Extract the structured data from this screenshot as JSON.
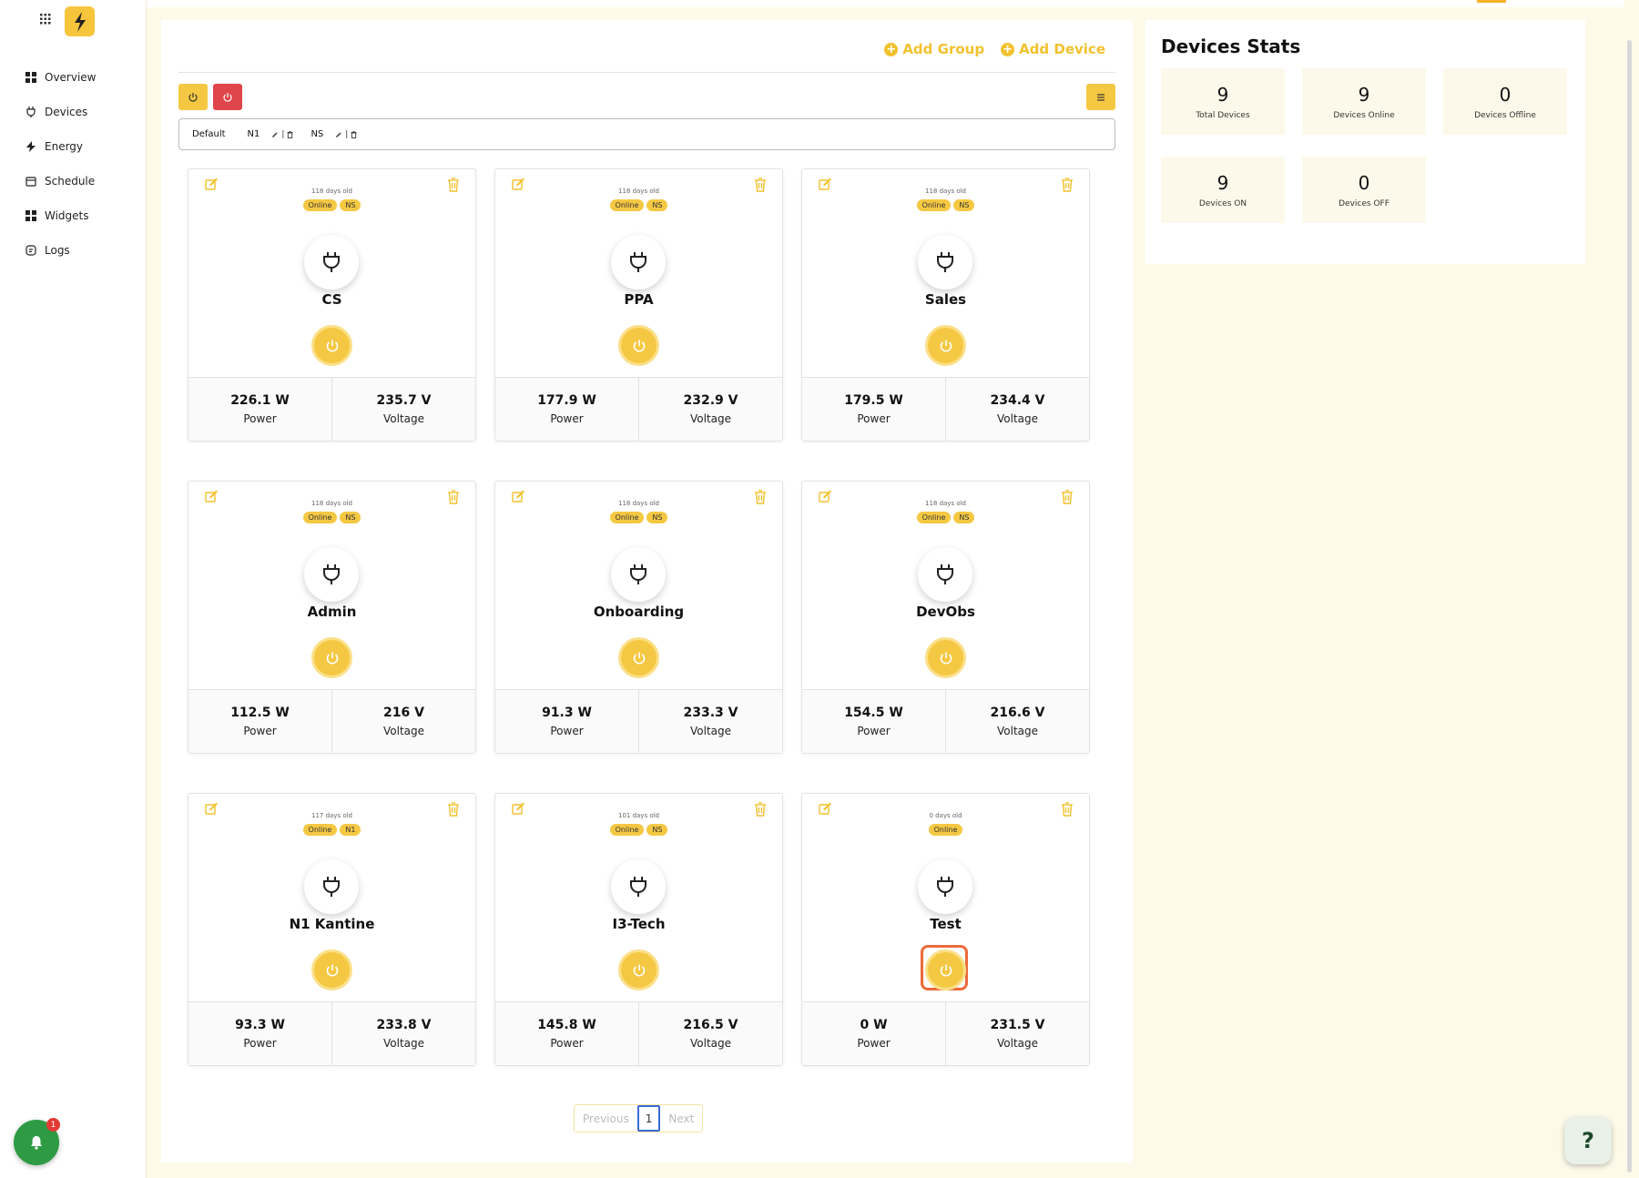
{
  "nav": [
    {
      "label": "Overview",
      "icon": "grid-icon"
    },
    {
      "label": "Devices",
      "icon": "plug-icon"
    },
    {
      "label": "Energy",
      "icon": "bolt-icon"
    },
    {
      "label": "Schedule",
      "icon": "calendar-icon"
    },
    {
      "label": "Widgets",
      "icon": "grid-icon"
    },
    {
      "label": "Logs",
      "icon": "log-icon"
    }
  ],
  "notifications": {
    "count": "1"
  },
  "help": {
    "label": "?"
  },
  "toolbar": {
    "add_group": "Add Group",
    "add_device": "Add Device"
  },
  "groups": [
    {
      "name": "Default",
      "editable": false
    },
    {
      "name": "N1",
      "editable": true
    },
    {
      "name": "NS",
      "editable": true
    }
  ],
  "devices": [
    {
      "name": "CS",
      "age": "118 days old",
      "status": "Online",
      "group": "NS",
      "power": "226.1 W",
      "voltage": "235.7 V"
    },
    {
      "name": "PPA",
      "age": "118 days old",
      "status": "Online",
      "group": "NS",
      "power": "177.9 W",
      "voltage": "232.9 V"
    },
    {
      "name": "Sales",
      "age": "118 days old",
      "status": "Online",
      "group": "NS",
      "power": "179.5 W",
      "voltage": "234.4 V"
    },
    {
      "name": "Admin",
      "age": "118 days old",
      "status": "Online",
      "group": "NS",
      "power": "112.5 W",
      "voltage": "216 V"
    },
    {
      "name": "Onboarding",
      "age": "118 days old",
      "status": "Online",
      "group": "NS",
      "power": "91.3 W",
      "voltage": "233.3 V"
    },
    {
      "name": "DevObs",
      "age": "118 days old",
      "status": "Online",
      "group": "NS",
      "power": "154.5 W",
      "voltage": "216.6 V"
    },
    {
      "name": "N1 Kantine",
      "age": "117 days old",
      "status": "Online",
      "group": "N1",
      "power": "93.3 W",
      "voltage": "233.8 V"
    },
    {
      "name": "I3-Tech",
      "age": "101 days old",
      "status": "Online",
      "group": "NS",
      "power": "145.8 W",
      "voltage": "216.5 V"
    },
    {
      "name": "Test",
      "age": "0 days old",
      "status": "Online",
      "group": "",
      "power": "0 W",
      "voltage": "231.5 V"
    }
  ],
  "labels": {
    "power": "Power",
    "voltage": "Voltage"
  },
  "pagination": {
    "previous": "Previous",
    "current": "1",
    "next": "Next"
  },
  "stats": {
    "title": "Devices Stats",
    "items": [
      {
        "value": "9",
        "label": "Total Devices"
      },
      {
        "value": "9",
        "label": "Devices Online"
      },
      {
        "value": "0",
        "label": "Devices Offline"
      },
      {
        "value": "9",
        "label": "Devices ON"
      },
      {
        "value": "0",
        "label": "Devices OFF"
      }
    ]
  },
  "colors": {
    "accent": "#f5c843",
    "danger": "#e0454b",
    "bell": "#2e9b44"
  }
}
